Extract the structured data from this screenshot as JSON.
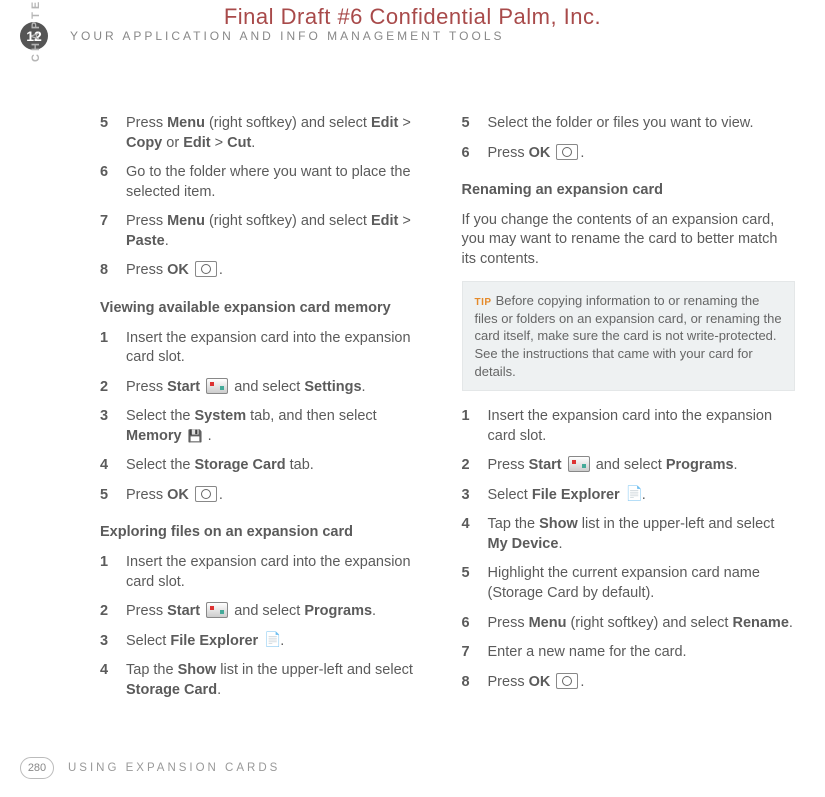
{
  "header": {
    "confidential": "Final Draft #6     Confidential     Palm, Inc."
  },
  "chapter": {
    "num": "12",
    "running": "YOUR APPLICATION AND INFO MANAGEMENT TOOLS",
    "label": "CHAPTER"
  },
  "footer": {
    "page": "280",
    "section": "USING EXPANSION CARDS"
  },
  "tip": {
    "label": "TIP",
    "text": "Before copying information to or renaming the files or folders on an expansion card, or renaming the card itself, make sure the card is not write-protected. See the instructions that came with your card for details."
  },
  "left": {
    "groupA": [
      {
        "n": "5",
        "parts": [
          "Press ",
          [
            "b",
            "Menu"
          ],
          " (right softkey) and select ",
          [
            "b",
            "Edit"
          ],
          " > ",
          [
            "b",
            "Copy"
          ],
          " or ",
          [
            "b",
            "Edit"
          ],
          " > ",
          [
            "b",
            "Cut"
          ],
          "."
        ]
      },
      {
        "n": "6",
        "parts": [
          "Go to the folder where you want to place the selected item."
        ]
      },
      {
        "n": "7",
        "parts": [
          "Press ",
          [
            "b",
            "Menu"
          ],
          " (right softkey) and select ",
          [
            "b",
            "Edit"
          ],
          " > ",
          [
            "b",
            "Paste"
          ],
          "."
        ]
      },
      {
        "n": "8",
        "parts": [
          "Press ",
          [
            "b",
            "OK"
          ],
          " ",
          [
            "ic",
            "ok"
          ],
          "."
        ]
      }
    ],
    "headingB": "Viewing available expansion card memory",
    "groupB": [
      {
        "n": "1",
        "parts": [
          "Insert the expansion card into the expansion card slot."
        ]
      },
      {
        "n": "2",
        "parts": [
          "Press ",
          [
            "b",
            "Start"
          ],
          " ",
          [
            "ic",
            "start"
          ],
          " and select ",
          [
            "b",
            "Settings"
          ],
          "."
        ]
      },
      {
        "n": "3",
        "parts": [
          "Select the ",
          [
            "b",
            "System"
          ],
          " tab, and then select ",
          [
            "b",
            "Memory"
          ],
          " ",
          [
            "ic",
            "mem"
          ],
          "."
        ]
      },
      {
        "n": "4",
        "parts": [
          "Select the ",
          [
            "b",
            "Storage Card"
          ],
          " tab."
        ]
      },
      {
        "n": "5",
        "parts": [
          "Press ",
          [
            "b",
            "OK"
          ],
          " ",
          [
            "ic",
            "ok"
          ],
          "."
        ]
      }
    ],
    "headingC": "Exploring files on an expansion card",
    "groupC": [
      {
        "n": "1",
        "parts": [
          "Insert the expansion card into the expansion card slot."
        ]
      },
      {
        "n": "2",
        "parts": [
          "Press ",
          [
            "b",
            "Start"
          ],
          " ",
          [
            "ic",
            "start"
          ],
          " and select ",
          [
            "b",
            "Programs"
          ],
          "."
        ]
      },
      {
        "n": "3",
        "parts": [
          "Select ",
          [
            "b",
            "File Explorer"
          ],
          " ",
          [
            "ic",
            "file"
          ],
          "."
        ]
      },
      {
        "n": "4",
        "parts": [
          "Tap the ",
          [
            "b",
            "Show"
          ],
          " list in the upper-left and select ",
          [
            "b",
            "Storage Card"
          ],
          "."
        ]
      }
    ]
  },
  "right": {
    "groupCont": [
      {
        "n": "5",
        "parts": [
          "Select the folder or files you want to view."
        ]
      },
      {
        "n": "6",
        "parts": [
          "Press ",
          [
            "b",
            "OK"
          ],
          " ",
          [
            "ic",
            "ok"
          ],
          "."
        ]
      }
    ],
    "headingD": "Renaming an expansion card",
    "paraD": "If you change the contents of an expansion card, you may want to rename the card to better match its contents.",
    "groupD": [
      {
        "n": "1",
        "parts": [
          "Insert the expansion card into the expansion card slot."
        ]
      },
      {
        "n": "2",
        "parts": [
          "Press ",
          [
            "b",
            "Start"
          ],
          " ",
          [
            "ic",
            "start"
          ],
          " and select ",
          [
            "b",
            "Programs"
          ],
          "."
        ]
      },
      {
        "n": "3",
        "parts": [
          "Select ",
          [
            "b",
            "File Explorer"
          ],
          " ",
          [
            "ic",
            "file"
          ],
          "."
        ]
      },
      {
        "n": "4",
        "parts": [
          "Tap the ",
          [
            "b",
            "Show"
          ],
          " list in the upper-left and select ",
          [
            "b",
            "My Device"
          ],
          "."
        ]
      },
      {
        "n": "5",
        "parts": [
          "Highlight the current expansion card name (Storage Card by default)."
        ]
      },
      {
        "n": "6",
        "parts": [
          "Press ",
          [
            "b",
            "Menu"
          ],
          " (right softkey) and select ",
          [
            "b",
            "Rename"
          ],
          "."
        ]
      },
      {
        "n": "7",
        "parts": [
          "Enter a new name for the card."
        ]
      },
      {
        "n": "8",
        "parts": [
          "Press ",
          [
            "b",
            "OK"
          ],
          " ",
          [
            "ic",
            "ok"
          ],
          "."
        ]
      }
    ]
  }
}
